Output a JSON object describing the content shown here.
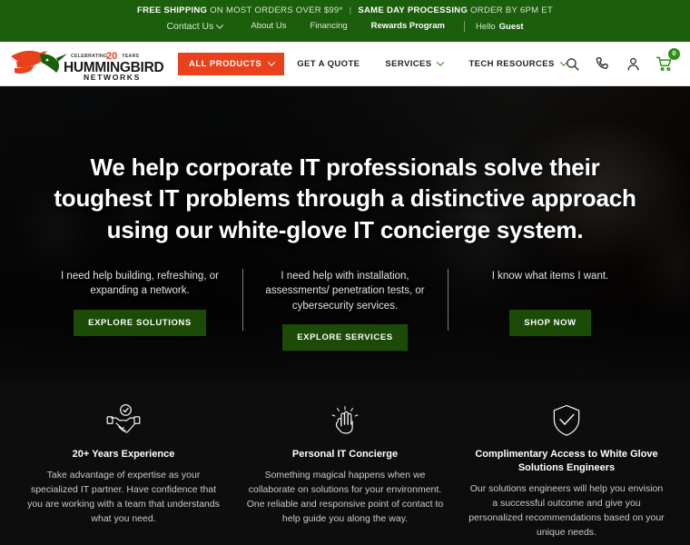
{
  "topbar": {
    "promo_bold_1": "FREE SHIPPING",
    "promo_text_1": " ON MOST ORDERS OVER $99*",
    "promo_separator": "|",
    "promo_bold_2": "SAME DAY PROCESSING",
    "promo_text_2": " ORDER BY 6PM ET",
    "links": [
      {
        "label": "Contact Us",
        "has_chevron": true
      },
      {
        "label": "About Us",
        "has_chevron": false
      },
      {
        "label": "Financing",
        "has_chevron": false
      },
      {
        "label": "Rewards Program",
        "has_chevron": false
      }
    ],
    "greeting_label": "Hello",
    "greeting_user": "Guest"
  },
  "logo": {
    "brand_line_1": "HUMMINGBIRD",
    "brand_line_2": "NETWORKS",
    "badge_prefix": "CELEBRATING",
    "badge_number": "20",
    "badge_suffix": "YEARS",
    "alt": "Hummingbird Networks"
  },
  "nav": {
    "primary_button": "ALL PRODUCTS",
    "items": [
      {
        "label": "GET A QUOTE",
        "has_chevron": false
      },
      {
        "label": "SERVICES",
        "has_chevron": true
      },
      {
        "label": "TECH RESOURCES",
        "has_chevron": true
      }
    ],
    "icons": [
      "search-icon",
      "phone-icon",
      "account-icon",
      "cart-icon"
    ],
    "cart_count": "0"
  },
  "hero": {
    "title": "We help corporate IT professionals solve their toughest IT problems through a distinctive approach using our white-glove IT concierge system.",
    "ctas": [
      {
        "text": "I need help building, refreshing, or expanding a network.",
        "button": "EXPLORE SOLUTIONS"
      },
      {
        "text": "I need help with installation, assessments/ penetration tests, or cybersecurity services.",
        "button": "EXPLORE SERVICES"
      },
      {
        "text": "I know what items I want.",
        "button": "SHOP NOW"
      }
    ]
  },
  "features": [
    {
      "icon": "handshake-check-icon",
      "title": "20+ Years Experience",
      "body": "Take advantage of expertise as your specialized IT partner. Have confidence that you are working with a team that understands what you need."
    },
    {
      "icon": "magic-hands-icon",
      "title": "Personal IT Concierge",
      "body": "Something magical happens when we collaborate on solutions for your environment. One reliable and responsive point of contact to help guide you along the way."
    },
    {
      "icon": "shield-check-icon",
      "title": "Complimentary Access to White Glove Solutions Engineers",
      "body": "Our solutions engineers will help you envision a successful outcome and give you personalized recommendations based on your unique needs."
    }
  ],
  "colors": {
    "topbar_green": "#1b5e0c",
    "accent_orange": "#e8411c",
    "button_green": "#1b4b06",
    "cart_badge_green": "#2f8f17",
    "page_dark": "#0d0d0d"
  }
}
